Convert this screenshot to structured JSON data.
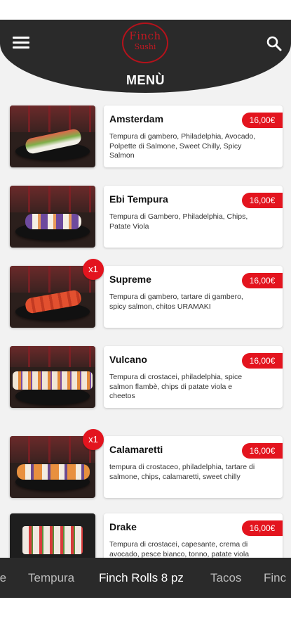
{
  "header": {
    "logo_line1": "Finch",
    "logo_line2": "Sushi",
    "title": "MENÙ",
    "colors": {
      "header_bg": "#2a2a2a",
      "accent": "#e3141e"
    }
  },
  "menu_items": [
    {
      "name": "Amsterdam",
      "price": "16,00€",
      "description": "Tempura di gambero, Philadelphia, Avocado, Polpette di Salmone, Sweet Chilly, Spicy Salmon",
      "quantity": ""
    },
    {
      "name": "Ebi Tempura",
      "price": "16,00€",
      "description": "Tempura di Gambero, Philadelphia, Chips, Patate Viola",
      "quantity": ""
    },
    {
      "name": "Supreme",
      "price": "16,00€",
      "description": "Tempura di gambero, tartare di gambero, spicy salmon, chitos URAMAKI",
      "quantity": "x1"
    },
    {
      "name": "Vulcano",
      "price": "16,00€",
      "description": "Tempura di crostacei, philadelphia, spice salmon flambè, chips di patate viola e cheetos",
      "quantity": ""
    },
    {
      "name": "Calamaretti",
      "price": "16,00€",
      "description": "tempura di crostaceo, philadelphia, tartare di salmone, chips, calamaretti, sweet chilly",
      "quantity": "x1"
    },
    {
      "name": "Drake",
      "price": "16,00€",
      "description": "Tempura di crostacei, capesante, crema di avocado, pesce bianco, tonno, patate viola",
      "quantity": ""
    }
  ],
  "category_tabs": [
    {
      "label": "re",
      "active": false
    },
    {
      "label": "Tempura",
      "active": false
    },
    {
      "label": "Finch Rolls 8 pz",
      "active": true
    },
    {
      "label": "Tacos",
      "active": false
    },
    {
      "label": "Finc",
      "active": false
    }
  ]
}
